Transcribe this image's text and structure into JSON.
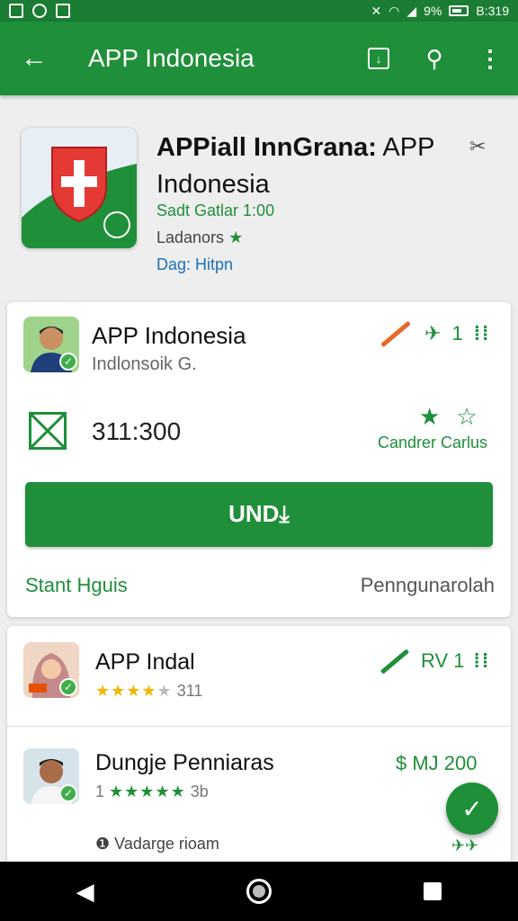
{
  "status": {
    "signal": "9%",
    "time": "B:319"
  },
  "header": {
    "title": "APP Indonesia"
  },
  "hero": {
    "title_bold": "APPiall InnGrana:",
    "title_rest": "APP Indonesia",
    "line1": "Sadt Gatlar 1:00",
    "line2": "Ladanors",
    "line3": "Dag: Hitpn"
  },
  "main_card": {
    "name": "APP Indonesia",
    "publisher": "Indlonsoik G.",
    "rank": "1",
    "size": "311:300",
    "rating_label": "Candrer Carlus",
    "install_label": "UND⤓",
    "link_left": "Stant Hguis",
    "link_right": "Penngunarolah"
  },
  "list": [
    {
      "title": "APP Indal",
      "rating_count": "311",
      "action_label": "RV 1",
      "rating": 4
    },
    {
      "title": "Dungje Penniaras",
      "rating_count": "3b",
      "prefix": "1",
      "price": "$ MJ 200",
      "rating": 5
    },
    {
      "subtitle": "Vadarge rioam"
    }
  ],
  "colors": {
    "primary": "#1f8f3a",
    "accent": "#e46b2b",
    "link": "#1b6fb5"
  }
}
